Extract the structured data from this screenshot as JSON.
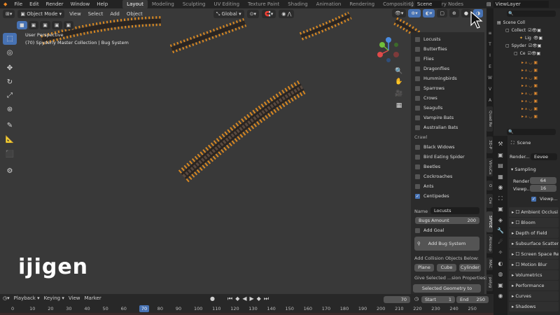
{
  "menu": [
    "File",
    "Edit",
    "Render",
    "Window",
    "Help"
  ],
  "workspaces": [
    "Layout",
    "Modeling",
    "Sculpting",
    "UV Editing",
    "Texture Paint",
    "Shading",
    "Animation",
    "Rendering",
    "Compositing",
    "Geometry Nodes"
  ],
  "scene_name": "Scene",
  "view_layer": "ViewLayer",
  "viewport_header": {
    "mode": "Object Mode",
    "view": "View",
    "select": "Select",
    "add": "Add",
    "object": "Object",
    "orientation": "Global"
  },
  "overlay": {
    "line1": "User Perspective",
    "line2": "(70) Spyderly Master Collection | Bug System"
  },
  "bugs": {
    "fly": [
      "Locusts",
      "Butterflies",
      "Flies",
      "Dragonflies",
      "Hummingbirds",
      "Sparrows",
      "Crows",
      "Seagulls",
      "Vampire Bats",
      "Australian Bats"
    ],
    "crawl_header": "Crawl",
    "crawl": [
      "Black Widows",
      "Bird Eating Spider",
      "Beetles",
      "Cockroaches",
      "Ants",
      "Centipedes"
    ],
    "name_label": "Name",
    "name_value": "Locusts",
    "amount_label": "Bugs Amount",
    "amount_value": "200",
    "add_goal": "Add Goal",
    "add_bug_system": "Add Bug System",
    "collision_label": "Add Collision Objects Below:",
    "plane": "Plane",
    "cube": "Cube",
    "cylinder": "Cylinder",
    "give_selected": "Give Selected ...sion Properties:",
    "selected_geometry": "Selected Geometry to Collision"
  },
  "side_tabs": [
    "Quad Re",
    "3D-P",
    "VirtuCa",
    "O",
    "Cre",
    "SPYDE",
    "Atmosp",
    "MAC",
    "polyg"
  ],
  "outliner": {
    "scene_coll": "Scene Coll",
    "collect": "Collect",
    "lig": "Lig",
    "spyder": "Spyder",
    "ce": "Ce"
  },
  "properties": {
    "scene": "Scene",
    "render_label": "Render...",
    "engine": "Eevee",
    "sampling": "Sampling",
    "render": "Render",
    "render_val": "64",
    "viewport": "Viewp...",
    "viewport_val": "16",
    "viewport_denoise": "Viewp...",
    "panels": [
      "Ambient Occlusi",
      "Bloom",
      "Depth of Field",
      "Subsurface Scatteri",
      "Screen Space Re",
      "Motion Blur",
      "Volumetrics",
      "Performance",
      "Curves",
      "Shadows"
    ]
  },
  "timeline": {
    "playback": "Playback",
    "keying": "Keying",
    "view": "View",
    "marker": "Marker",
    "current": "70",
    "start_label": "Start",
    "start": "1",
    "end_label": "End",
    "end": "250",
    "ticks": [
      "0",
      "10",
      "20",
      "30",
      "40",
      "50",
      "60",
      "70",
      "80",
      "90",
      "100",
      "110",
      "120",
      "130",
      "140",
      "150",
      "160",
      "170",
      "180",
      "190",
      "200",
      "210",
      "220",
      "230",
      "240",
      "250"
    ]
  },
  "watermark": "ijigen",
  "colors": {
    "accent": "#4772b3",
    "centipede_orange": "#f5961e",
    "playhead": "#4772b3"
  }
}
